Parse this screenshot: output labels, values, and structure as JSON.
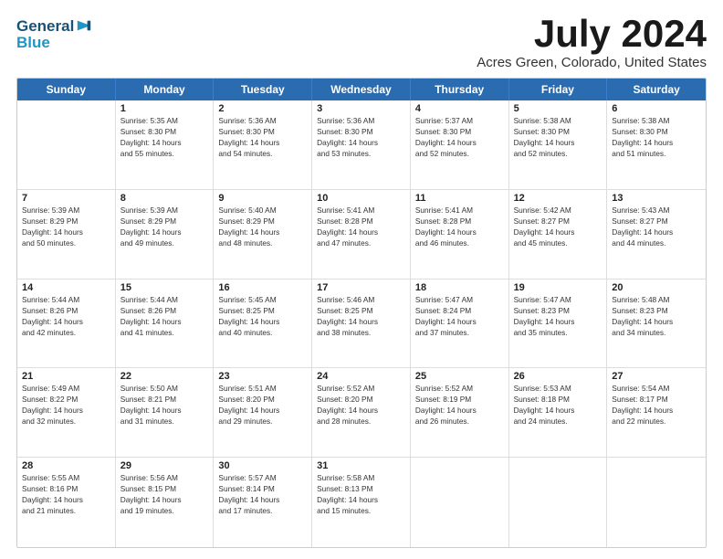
{
  "logo": {
    "line1": "General",
    "line2": "Blue",
    "icon": "▶"
  },
  "title": "July 2024",
  "subtitle": "Acres Green, Colorado, United States",
  "header_days": [
    "Sunday",
    "Monday",
    "Tuesday",
    "Wednesday",
    "Thursday",
    "Friday",
    "Saturday"
  ],
  "weeks": [
    [
      {
        "num": "",
        "lines": []
      },
      {
        "num": "1",
        "lines": [
          "Sunrise: 5:35 AM",
          "Sunset: 8:30 PM",
          "Daylight: 14 hours",
          "and 55 minutes."
        ]
      },
      {
        "num": "2",
        "lines": [
          "Sunrise: 5:36 AM",
          "Sunset: 8:30 PM",
          "Daylight: 14 hours",
          "and 54 minutes."
        ]
      },
      {
        "num": "3",
        "lines": [
          "Sunrise: 5:36 AM",
          "Sunset: 8:30 PM",
          "Daylight: 14 hours",
          "and 53 minutes."
        ]
      },
      {
        "num": "4",
        "lines": [
          "Sunrise: 5:37 AM",
          "Sunset: 8:30 PM",
          "Daylight: 14 hours",
          "and 52 minutes."
        ]
      },
      {
        "num": "5",
        "lines": [
          "Sunrise: 5:38 AM",
          "Sunset: 8:30 PM",
          "Daylight: 14 hours",
          "and 52 minutes."
        ]
      },
      {
        "num": "6",
        "lines": [
          "Sunrise: 5:38 AM",
          "Sunset: 8:30 PM",
          "Daylight: 14 hours",
          "and 51 minutes."
        ]
      }
    ],
    [
      {
        "num": "7",
        "lines": [
          "Sunrise: 5:39 AM",
          "Sunset: 8:29 PM",
          "Daylight: 14 hours",
          "and 50 minutes."
        ]
      },
      {
        "num": "8",
        "lines": [
          "Sunrise: 5:39 AM",
          "Sunset: 8:29 PM",
          "Daylight: 14 hours",
          "and 49 minutes."
        ]
      },
      {
        "num": "9",
        "lines": [
          "Sunrise: 5:40 AM",
          "Sunset: 8:29 PM",
          "Daylight: 14 hours",
          "and 48 minutes."
        ]
      },
      {
        "num": "10",
        "lines": [
          "Sunrise: 5:41 AM",
          "Sunset: 8:28 PM",
          "Daylight: 14 hours",
          "and 47 minutes."
        ]
      },
      {
        "num": "11",
        "lines": [
          "Sunrise: 5:41 AM",
          "Sunset: 8:28 PM",
          "Daylight: 14 hours",
          "and 46 minutes."
        ]
      },
      {
        "num": "12",
        "lines": [
          "Sunrise: 5:42 AM",
          "Sunset: 8:27 PM",
          "Daylight: 14 hours",
          "and 45 minutes."
        ]
      },
      {
        "num": "13",
        "lines": [
          "Sunrise: 5:43 AM",
          "Sunset: 8:27 PM",
          "Daylight: 14 hours",
          "and 44 minutes."
        ]
      }
    ],
    [
      {
        "num": "14",
        "lines": [
          "Sunrise: 5:44 AM",
          "Sunset: 8:26 PM",
          "Daylight: 14 hours",
          "and 42 minutes."
        ]
      },
      {
        "num": "15",
        "lines": [
          "Sunrise: 5:44 AM",
          "Sunset: 8:26 PM",
          "Daylight: 14 hours",
          "and 41 minutes."
        ]
      },
      {
        "num": "16",
        "lines": [
          "Sunrise: 5:45 AM",
          "Sunset: 8:25 PM",
          "Daylight: 14 hours",
          "and 40 minutes."
        ]
      },
      {
        "num": "17",
        "lines": [
          "Sunrise: 5:46 AM",
          "Sunset: 8:25 PM",
          "Daylight: 14 hours",
          "and 38 minutes."
        ]
      },
      {
        "num": "18",
        "lines": [
          "Sunrise: 5:47 AM",
          "Sunset: 8:24 PM",
          "Daylight: 14 hours",
          "and 37 minutes."
        ]
      },
      {
        "num": "19",
        "lines": [
          "Sunrise: 5:47 AM",
          "Sunset: 8:23 PM",
          "Daylight: 14 hours",
          "and 35 minutes."
        ]
      },
      {
        "num": "20",
        "lines": [
          "Sunrise: 5:48 AM",
          "Sunset: 8:23 PM",
          "Daylight: 14 hours",
          "and 34 minutes."
        ]
      }
    ],
    [
      {
        "num": "21",
        "lines": [
          "Sunrise: 5:49 AM",
          "Sunset: 8:22 PM",
          "Daylight: 14 hours",
          "and 32 minutes."
        ]
      },
      {
        "num": "22",
        "lines": [
          "Sunrise: 5:50 AM",
          "Sunset: 8:21 PM",
          "Daylight: 14 hours",
          "and 31 minutes."
        ]
      },
      {
        "num": "23",
        "lines": [
          "Sunrise: 5:51 AM",
          "Sunset: 8:20 PM",
          "Daylight: 14 hours",
          "and 29 minutes."
        ]
      },
      {
        "num": "24",
        "lines": [
          "Sunrise: 5:52 AM",
          "Sunset: 8:20 PM",
          "Daylight: 14 hours",
          "and 28 minutes."
        ]
      },
      {
        "num": "25",
        "lines": [
          "Sunrise: 5:52 AM",
          "Sunset: 8:19 PM",
          "Daylight: 14 hours",
          "and 26 minutes."
        ]
      },
      {
        "num": "26",
        "lines": [
          "Sunrise: 5:53 AM",
          "Sunset: 8:18 PM",
          "Daylight: 14 hours",
          "and 24 minutes."
        ]
      },
      {
        "num": "27",
        "lines": [
          "Sunrise: 5:54 AM",
          "Sunset: 8:17 PM",
          "Daylight: 14 hours",
          "and 22 minutes."
        ]
      }
    ],
    [
      {
        "num": "28",
        "lines": [
          "Sunrise: 5:55 AM",
          "Sunset: 8:16 PM",
          "Daylight: 14 hours",
          "and 21 minutes."
        ]
      },
      {
        "num": "29",
        "lines": [
          "Sunrise: 5:56 AM",
          "Sunset: 8:15 PM",
          "Daylight: 14 hours",
          "and 19 minutes."
        ]
      },
      {
        "num": "30",
        "lines": [
          "Sunrise: 5:57 AM",
          "Sunset: 8:14 PM",
          "Daylight: 14 hours",
          "and 17 minutes."
        ]
      },
      {
        "num": "31",
        "lines": [
          "Sunrise: 5:58 AM",
          "Sunset: 8:13 PM",
          "Daylight: 14 hours",
          "and 15 minutes."
        ]
      },
      {
        "num": "",
        "lines": []
      },
      {
        "num": "",
        "lines": []
      },
      {
        "num": "",
        "lines": []
      }
    ]
  ]
}
